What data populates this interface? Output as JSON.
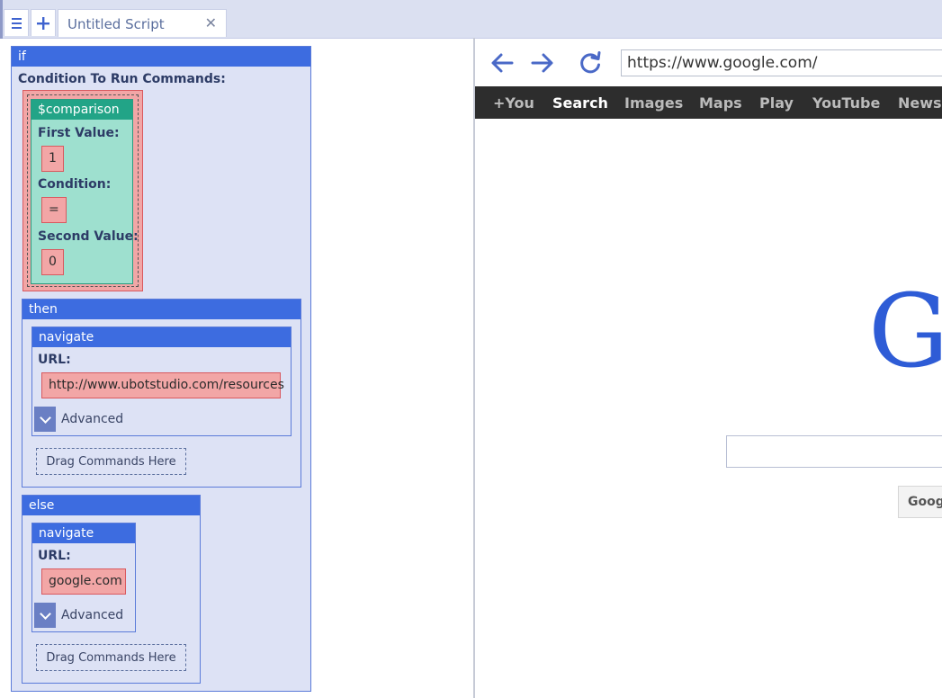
{
  "tabbar": {
    "menu_icon": "hamburger-icon",
    "add_icon": "plus-icon",
    "tab_title": "Untitled Script",
    "close_glyph": "✕"
  },
  "script": {
    "if_block": {
      "title": "if",
      "condition_label": "Condition To Run Commands:",
      "comparison": {
        "title": "$comparison",
        "first_value_label": "First Value:",
        "first_value": "1",
        "condition_label": "Condition:",
        "condition": "=",
        "second_value_label": "Second Value:",
        "second_value": "0"
      }
    },
    "then_block": {
      "title": "then",
      "navigate": {
        "title": "navigate",
        "url_label": "URL:",
        "url": "http://www.ubotstudio.com/resources",
        "advanced_label": "Advanced"
      },
      "dropzone": "Drag Commands Here"
    },
    "else_block": {
      "title": "else",
      "navigate": {
        "title": "navigate",
        "url_label": "URL:",
        "url": "google.com",
        "advanced_label": "Advanced"
      },
      "dropzone": "Drag Commands Here"
    }
  },
  "browser": {
    "url": "https://www.google.com/",
    "nav_icons": [
      "back-arrow-icon",
      "forward-arrow-icon",
      "reload-icon"
    ],
    "google_bar": [
      "+You",
      "Search",
      "Images",
      "Maps",
      "Play",
      "YouTube",
      "News"
    ],
    "active_item": "Search",
    "logo_letter": "G",
    "search_button": "Goog"
  },
  "colors": {
    "block_header": "#3d6ce0",
    "block_body": "#dde2f5",
    "comparison_header": "#22a487",
    "comparison_body": "#9ee0cf",
    "param_fill": "#f2a6a6",
    "google_bar": "#2d2d2d"
  }
}
